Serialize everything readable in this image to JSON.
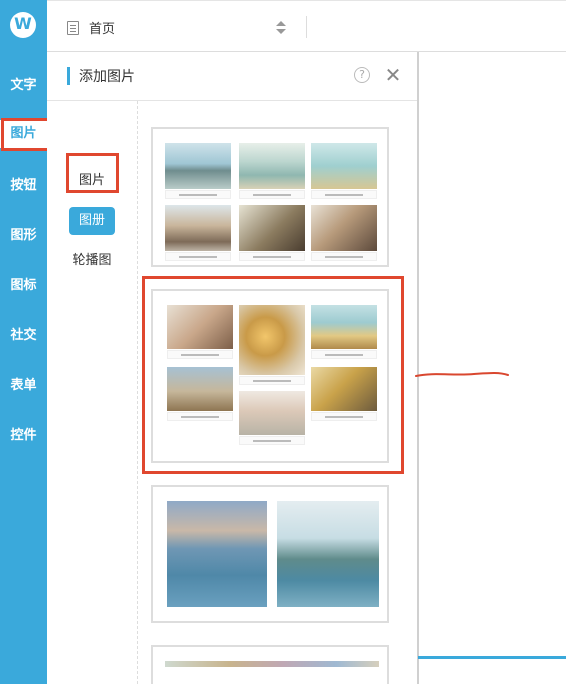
{
  "sidebar": {
    "logo_icon": "brand-w-logo",
    "logo_letter": "W",
    "items": [
      {
        "label": "文字"
      },
      {
        "label": "图片"
      },
      {
        "label": "按钮"
      },
      {
        "label": "图形"
      },
      {
        "label": "图标"
      },
      {
        "label": "社交"
      },
      {
        "label": "表单"
      },
      {
        "label": "控件"
      }
    ],
    "active_index": 1
  },
  "topbar": {
    "page_icon": "page-icon",
    "page_select": "首页",
    "sort_icon": "sort-updown-icon"
  },
  "panel": {
    "title": "添加图片",
    "help_icon": "help-icon",
    "help_glyph": "?",
    "close_icon": "close-icon",
    "close_glyph": "✕",
    "subnav": [
      {
        "label": "图片"
      },
      {
        "label": "图册"
      },
      {
        "label": "轮播图"
      }
    ],
    "subnav_active_index": 1
  },
  "colors": {
    "accent": "#3aa9db",
    "highlight": "#e0472f"
  }
}
